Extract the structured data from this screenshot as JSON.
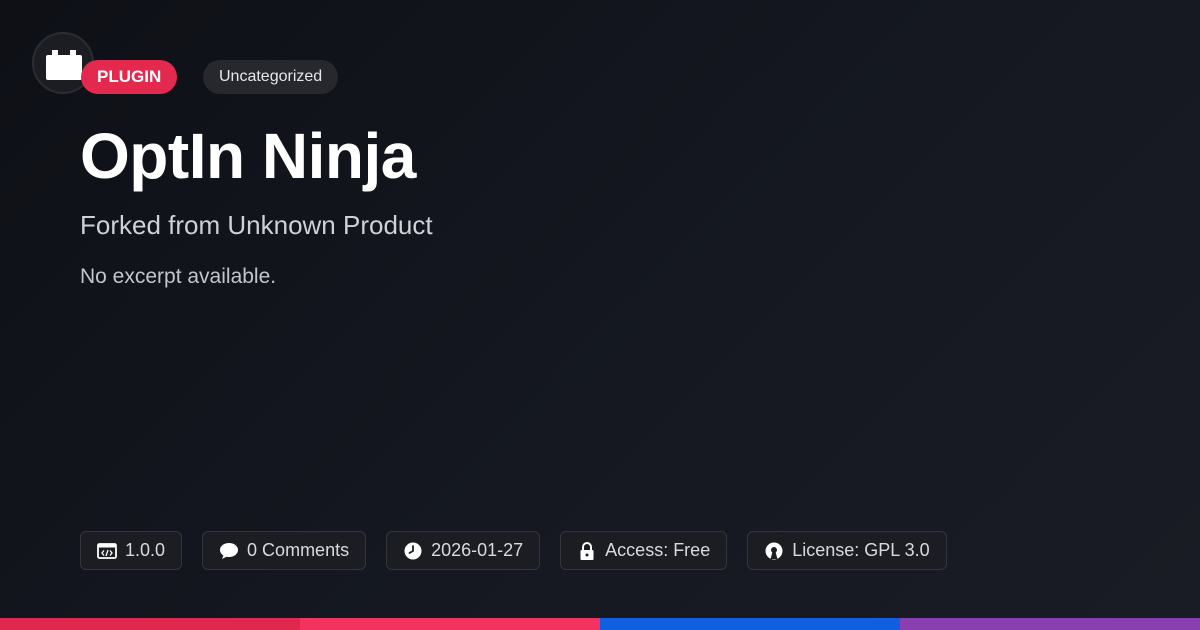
{
  "logo": {
    "icon": "plugin-block-icon"
  },
  "badges": {
    "type": "PLUGIN",
    "category": "Uncategorized"
  },
  "post": {
    "title": "OptIn Ninja",
    "subtitle": "Forked from Unknown Product",
    "excerpt": "No excerpt available."
  },
  "meta": {
    "version": "1.0.0",
    "comments": "0 Comments",
    "date": "2026-01-27",
    "access": "Access: Free",
    "license": "License: GPL 3.0"
  },
  "colors": {
    "accent_red": "#e4294f",
    "stripe": [
      "#e0284f",
      "#f4325f",
      "#0f5fe0",
      "#8a3fb0"
    ]
  }
}
